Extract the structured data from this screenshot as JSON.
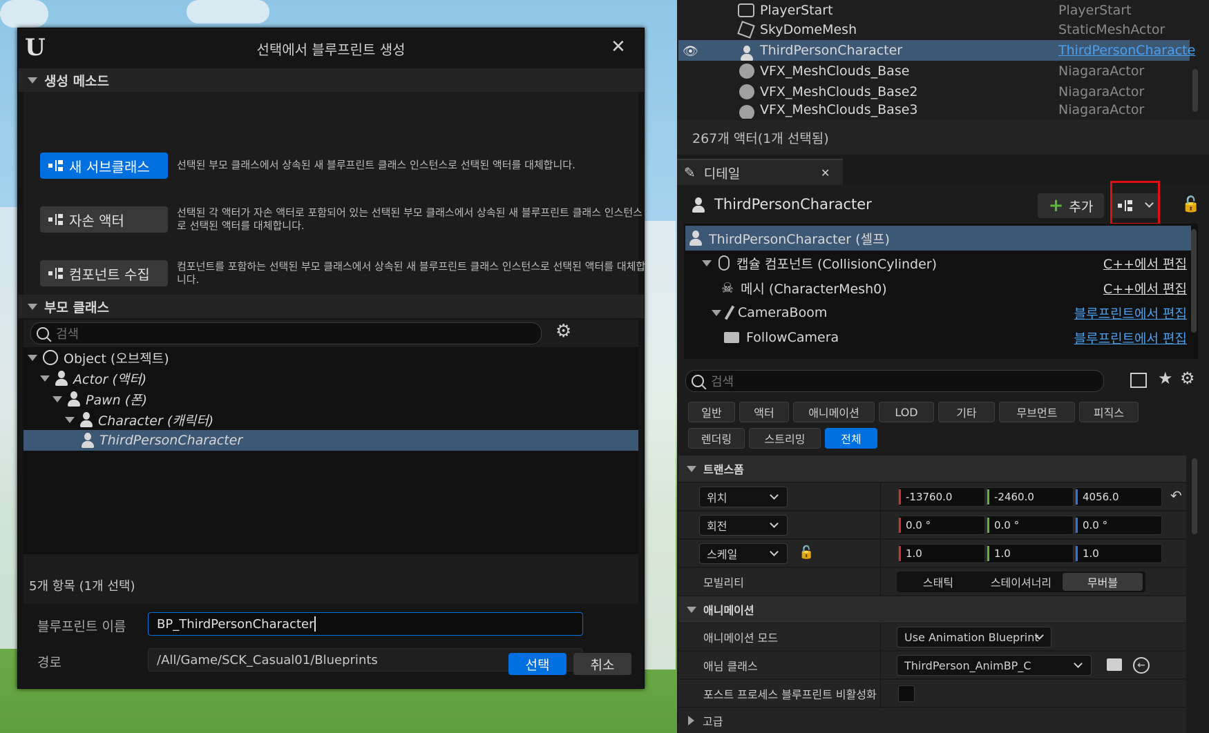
{
  "dialog": {
    "title": "선택에서 블루프린트 생성",
    "creation_method_header": "생성 메소드",
    "methods": [
      {
        "label": "새 서브클래스",
        "desc": "선택된 부모 클래스에서 상속된 새 블루프린트 클래스 인스턴스로 선택된 액터를 대체합니다."
      },
      {
        "label": "자손 액터",
        "desc": "선택된 각 액터가 자손 액터로 포함되어 있는 선택된 부모 클래스에서 상속된 새 블루프린트 클래스 인스턴스로 선택된 액터를 대체합니다."
      },
      {
        "label": "컴포넌트 수집",
        "desc": "컴포넌트를 포함하는 선택된 부모 클래스에서 상속된 새 블루프린트 클래스 인스턴스로 선택된 액터를 대체합니다."
      }
    ],
    "parent_class_header": "부모 클래스",
    "search_placeholder": "검색",
    "tree": [
      {
        "label": "Object (오브젝트)",
        "icon": "object-icon"
      },
      {
        "label": "Actor (액터)",
        "icon": "actor-icon"
      },
      {
        "label": "Pawn (폰)",
        "icon": "pawn-icon"
      },
      {
        "label": "Character (캐릭터)",
        "icon": "character-icon"
      },
      {
        "label": "ThirdPersonCharacter",
        "icon": "character-icon"
      }
    ],
    "item_count": "5개 항목 (1개 선택)",
    "bp_name_label": "블루프린트 이름",
    "bp_name_value": "BP_ThirdPersonCharacter",
    "path_label": "경로",
    "path_value": "/All/Game/SCK_Casual01/Blueprints",
    "select_button": "선택",
    "cancel_button": "취소"
  },
  "outliner": {
    "rows": [
      {
        "name": "PlayerStart",
        "type": "PlayerStart"
      },
      {
        "name": "SkyDomeMesh",
        "type": "StaticMeshActor"
      },
      {
        "name": "ThirdPersonCharacter",
        "type": "ThirdPersonCharacte"
      },
      {
        "name": "VFX_MeshClouds_Base",
        "type": "NiagaraActor"
      },
      {
        "name": "VFX_MeshClouds_Base2",
        "type": "NiagaraActor"
      },
      {
        "name": "VFX_MeshClouds_Base3",
        "type": "NiagaraActor"
      }
    ],
    "status": "267개 액터(1개 선택됨)"
  },
  "details": {
    "tab_label": "디테일",
    "actor_name": "ThirdPersonCharacter",
    "add_button": "추가",
    "components": [
      {
        "label": "ThirdPersonCharacter (셀프)",
        "edit": ""
      },
      {
        "label": "캡슐 컴포넌트 (CollisionCylinder)",
        "edit": "C++에서 편집"
      },
      {
        "label": "메시 (CharacterMesh0)",
        "edit": "C++에서 편집"
      },
      {
        "label": "CameraBoom",
        "edit": "블루프린트에서 편집"
      },
      {
        "label": "FollowCamera",
        "edit": "블루프린트에서 편집"
      }
    ],
    "search_placeholder": "검색",
    "filters_row1": [
      "일반",
      "액터",
      "애니메이션",
      "LOD",
      "기타",
      "무브먼트",
      "피직스"
    ],
    "filters_row2": [
      "렌더링",
      "스트리밍",
      "전체"
    ],
    "transform_header": "트랜스폼",
    "location_label": "위치",
    "location": [
      "-13760.0",
      "-2460.0",
      "4056.0"
    ],
    "rotation_label": "회전",
    "rotation": [
      "0.0 °",
      "0.0 °",
      "0.0 °"
    ],
    "scale_label": "스케일",
    "scale": [
      "1.0",
      "1.0",
      "1.0"
    ],
    "mobility_label": "모빌리티",
    "mobility_options": [
      "스태틱",
      "스테이셔너리",
      "무버블"
    ],
    "animation_header": "애니메이션",
    "anim_mode_label": "애니메이션 모드",
    "anim_mode_value": "Use Animation Blueprint",
    "anim_class_label": "애님 클래스",
    "anim_class_value": "ThirdPerson_AnimBP_C",
    "post_process_label": "포스트 프로세스 블루프린트 비활성화",
    "advanced_label": "고급"
  },
  "colors": {
    "accent": "#0070e0",
    "highlight_box": "#e01010",
    "selection": "#3d5874"
  }
}
